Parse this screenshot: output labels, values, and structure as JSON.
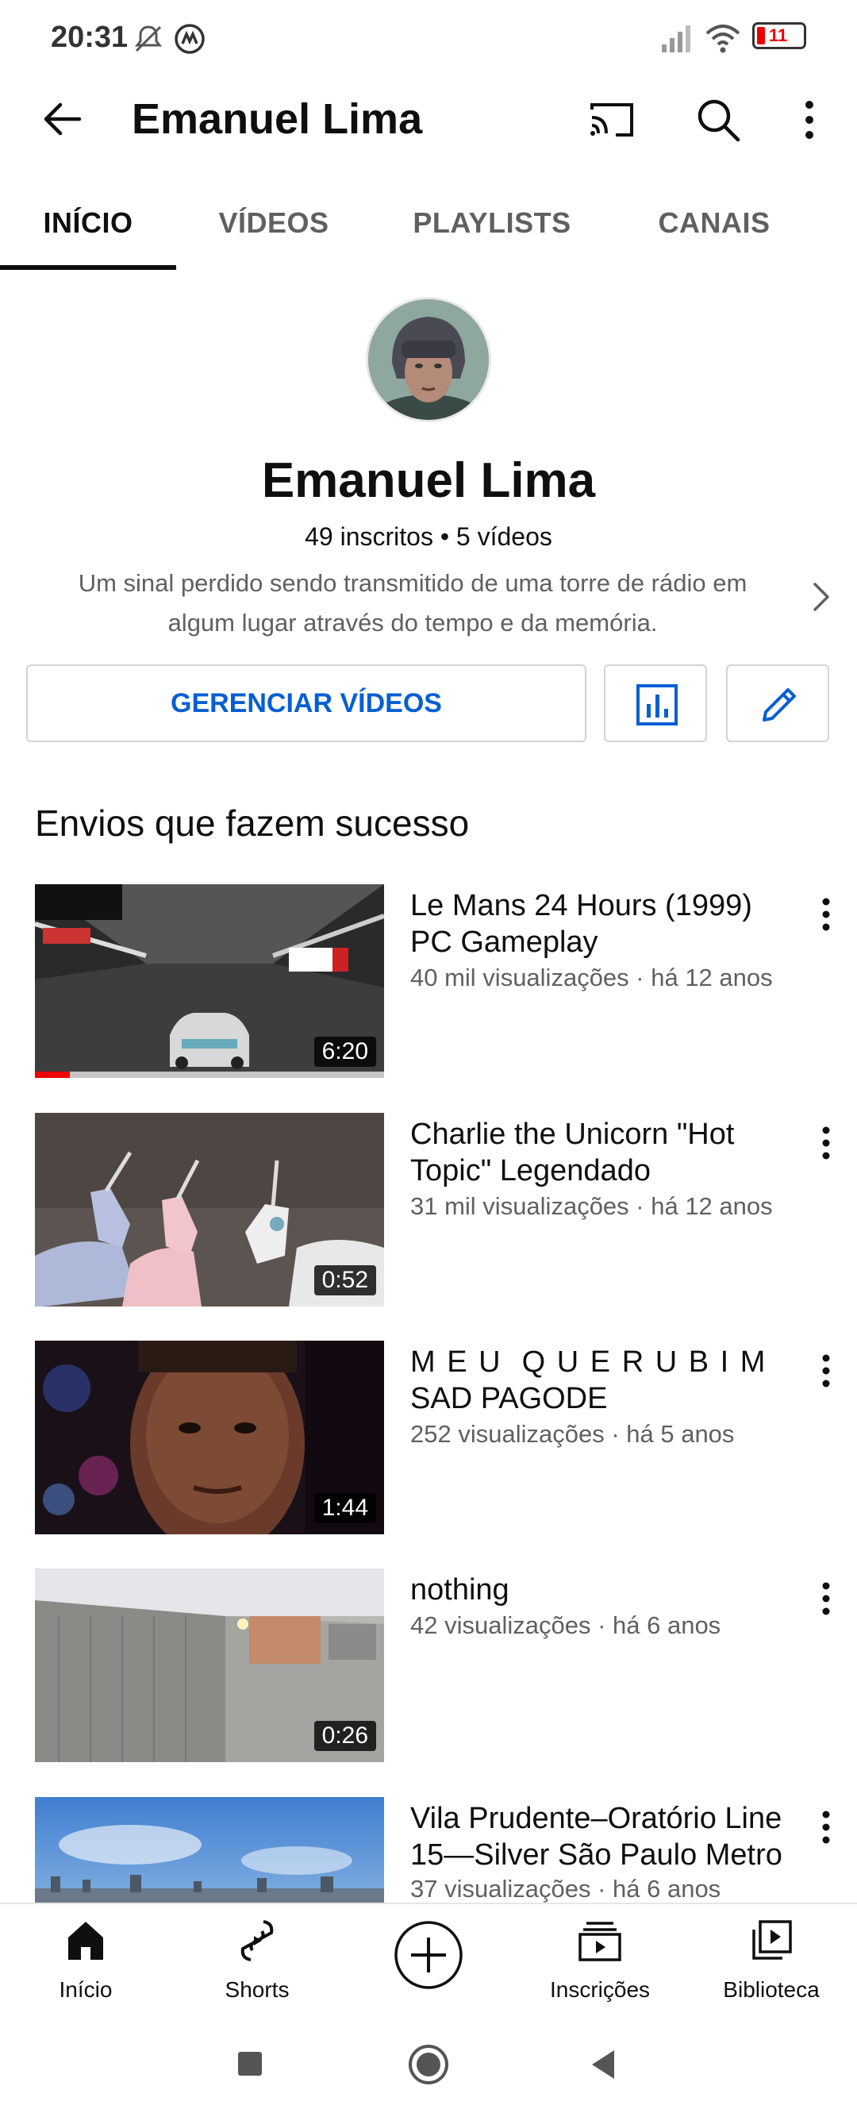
{
  "status_bar": {
    "time": "20:31",
    "battery": "11"
  },
  "header": {
    "title": "Emanuel Lima"
  },
  "tabs": [
    {
      "label": "INÍCIO",
      "active": true
    },
    {
      "label": "VÍDEOS",
      "active": false
    },
    {
      "label": "PLAYLISTS",
      "active": false
    },
    {
      "label": "CANAIS",
      "active": false
    }
  ],
  "channel": {
    "name": "Emanuel Lima",
    "stats": "49 inscritos • 5 vídeos",
    "description_line1": "Um sinal perdido sendo transmitido de uma torre de rádio em",
    "description_line2": "algum lugar através do tempo e da memória.",
    "manage_button": "GERENCIAR VÍDEOS"
  },
  "section": {
    "title": "Envios que fazem sucesso"
  },
  "videos": [
    {
      "title_line1": "Le Mans 24 Hours (1999)",
      "title_line2": "PC Gameplay",
      "meta": "40 mil visualizações · há 12 anos",
      "duration": "6:20",
      "watched_fraction": 0.1
    },
    {
      "title_line1": "Charlie the Unicorn \"Hot",
      "title_line2": "Topic\" Legendado",
      "meta": "31 mil visualizações · há 12 anos",
      "duration": "0:52"
    },
    {
      "title_line1": "M E U  Q U E R U B I M",
      "title_line2": "SAD PAGODE",
      "meta": "252 visualizações · há 5 anos",
      "duration": "1:44"
    },
    {
      "title_line1": "nothing",
      "title_line2": "",
      "meta": "42 visualizações · há 6 anos",
      "duration": "0:26"
    },
    {
      "title_line1": "Vila Prudente–Oratório Line",
      "title_line2": "15—Silver São Paulo Metro",
      "meta": "37 visualizações · há 6 anos",
      "duration": ""
    }
  ],
  "bottom_nav": {
    "home": "Início",
    "shorts": "Shorts",
    "subscriptions": "Inscrições",
    "library": "Biblioteca"
  },
  "colors": {
    "accent_blue": "#065fd4",
    "progress_red": "#ee0000",
    "text_primary": "#0f0f0f",
    "text_secondary": "#606060"
  }
}
